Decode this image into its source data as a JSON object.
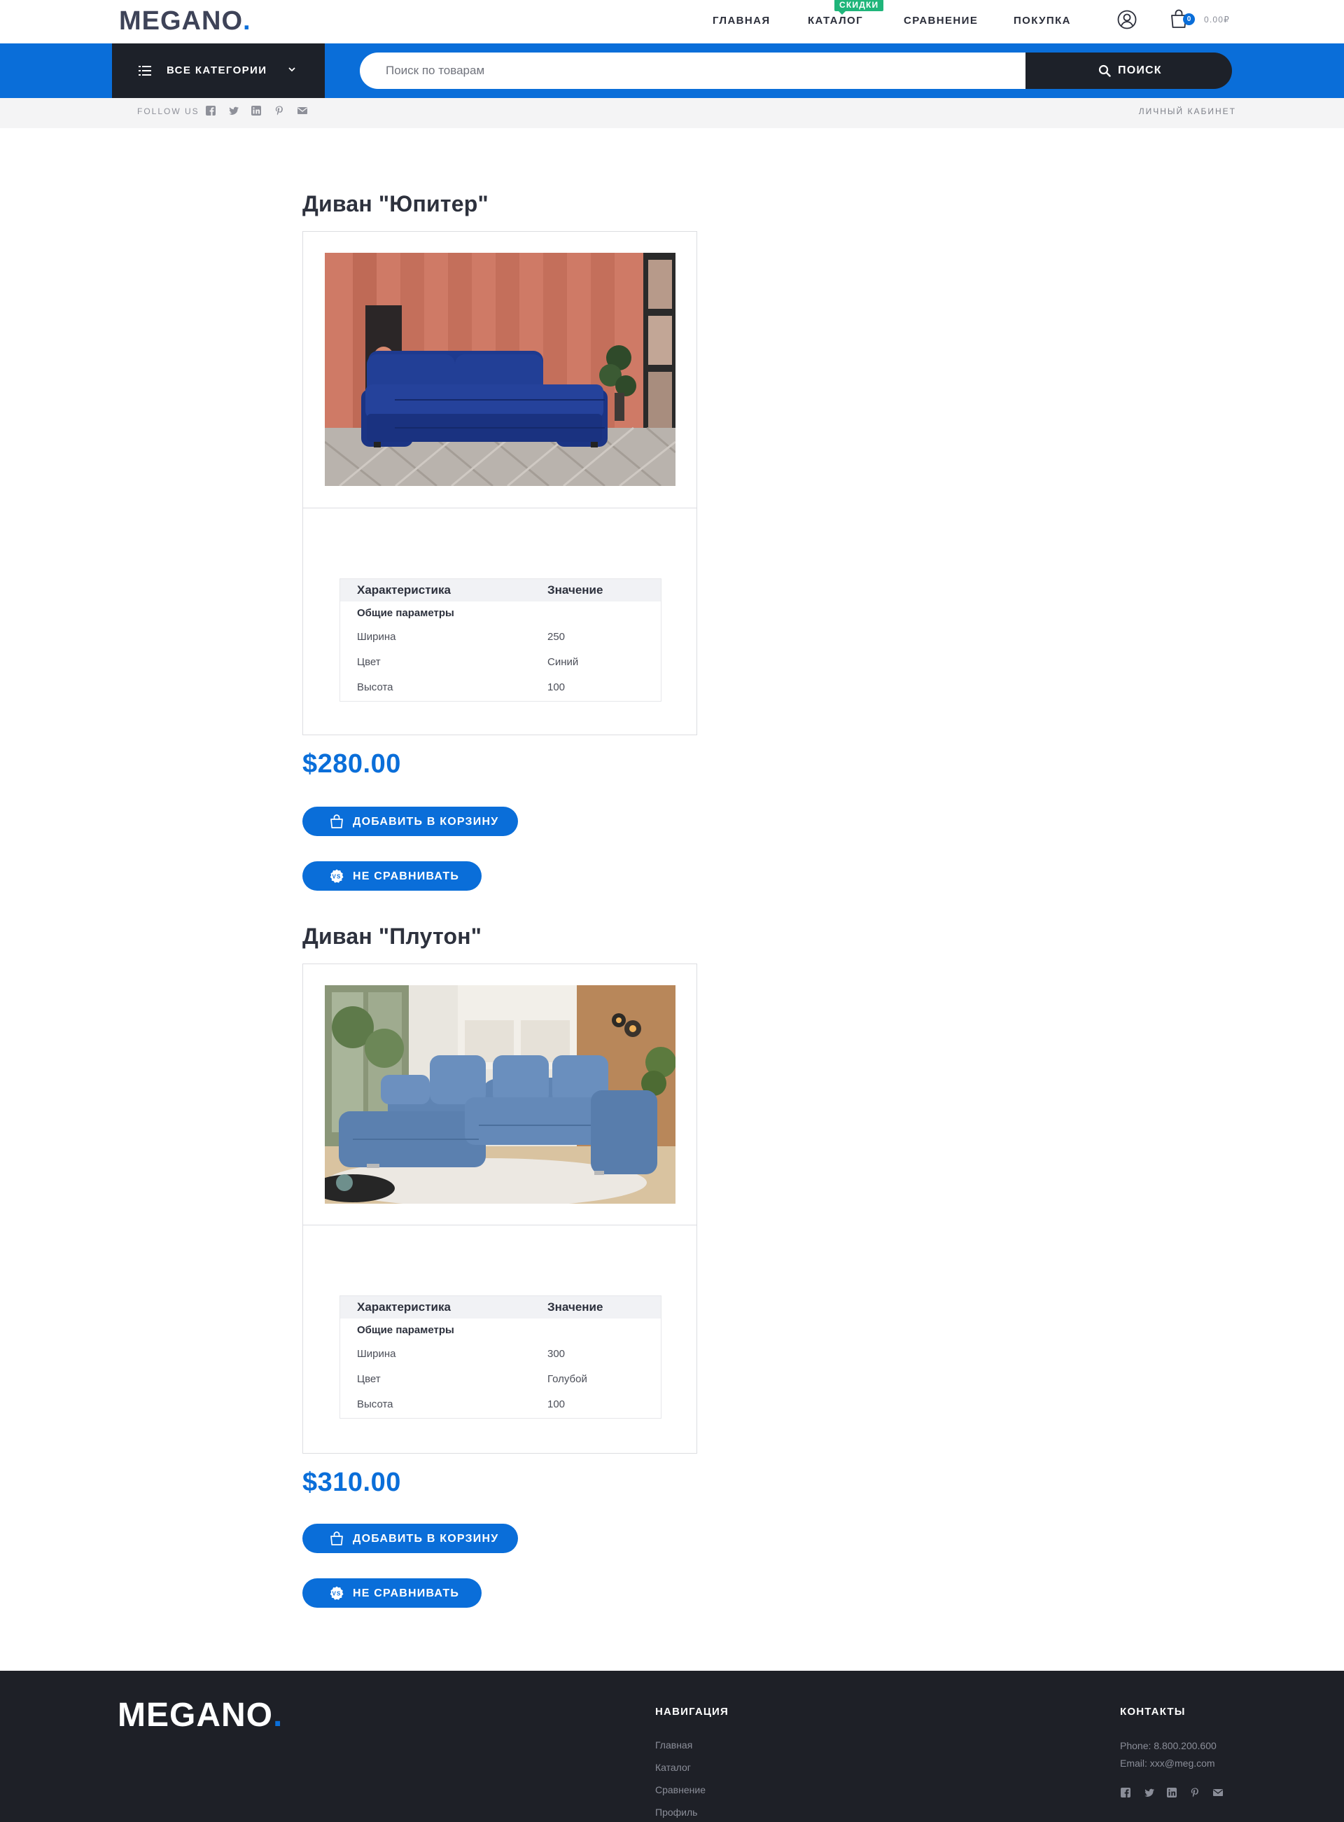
{
  "brand": {
    "logo_text": "MEGANO",
    "logo_dot": ".",
    "accent_color": "#0a6ed9",
    "dark_color": "#1d2129",
    "sale_color": "#1fb57a"
  },
  "nav": {
    "items": [
      {
        "label": "ГЛАВНАЯ"
      },
      {
        "label": "КАТАЛОГ",
        "badge": "СКИДКИ"
      },
      {
        "label": "СРАВНЕНИЕ"
      },
      {
        "label": "ПОКУПКА"
      }
    ],
    "user_icon": "user-icon",
    "cart_icon": "shopping-bag-icon",
    "cart_count": "0",
    "cart_total": "0.00₽"
  },
  "categories": {
    "label": "ВСЕ КАТЕГОРИИ",
    "icon": "list-icon",
    "chevron": "chevron-down-icon"
  },
  "search": {
    "placeholder": "Поиск по товарам",
    "value": "",
    "button_label": "ПОИСК",
    "button_icon": "search-icon"
  },
  "subbar": {
    "follow_label": "FOLLOW US",
    "social_icons": [
      "facebook-icon",
      "twitter-icon",
      "linkedin-icon",
      "pinterest-icon",
      "mail-icon"
    ],
    "account_link": "ЛИЧНЫЙ КАБИНЕТ"
  },
  "products": [
    {
      "title": "Диван \"Юпитер\"",
      "image_desc": "dark blue sofa in a room with coral striped walls",
      "spec_header": [
        "Характеристика",
        "Значение"
      ],
      "spec_group": "Общие параметры",
      "specs": [
        {
          "key": "Ширина",
          "value": "250"
        },
        {
          "key": "Цвет",
          "value": "Синий"
        },
        {
          "key": "Высота",
          "value": "100"
        }
      ],
      "price": "$280.00",
      "add_to_cart": "ДОБАВИТЬ В КОРЗИНУ",
      "compare": "НЕ СРАВНИВАТЬ"
    },
    {
      "title": "Диван \"Плутон\"",
      "image_desc": "light blue corner sofa in a bright living room",
      "spec_header": [
        "Характеристика",
        "Значение"
      ],
      "spec_group": "Общие параметры",
      "specs": [
        {
          "key": "Ширина",
          "value": "300"
        },
        {
          "key": "Цвет",
          "value": "Голубой"
        },
        {
          "key": "Высота",
          "value": "100"
        }
      ],
      "price": "$310.00",
      "add_to_cart": "ДОБАВИТЬ В КОРЗИНУ",
      "compare": "НЕ СРАВНИВАТЬ"
    }
  ],
  "footer": {
    "logo_text": "MEGANO",
    "logo_dot": ".",
    "nav_title": "НАВИГАЦИЯ",
    "nav_links": [
      "Главная",
      "Каталог",
      "Сравнение",
      "Профиль"
    ],
    "contacts_title": "КОНТАКТЫ",
    "phone": "Phone: 8.800.200.600",
    "email": "Email: xxx@meg.com",
    "social_icons": [
      "facebook-icon",
      "twitter-icon",
      "linkedin-icon",
      "pinterest-icon",
      "mail-icon"
    ]
  }
}
